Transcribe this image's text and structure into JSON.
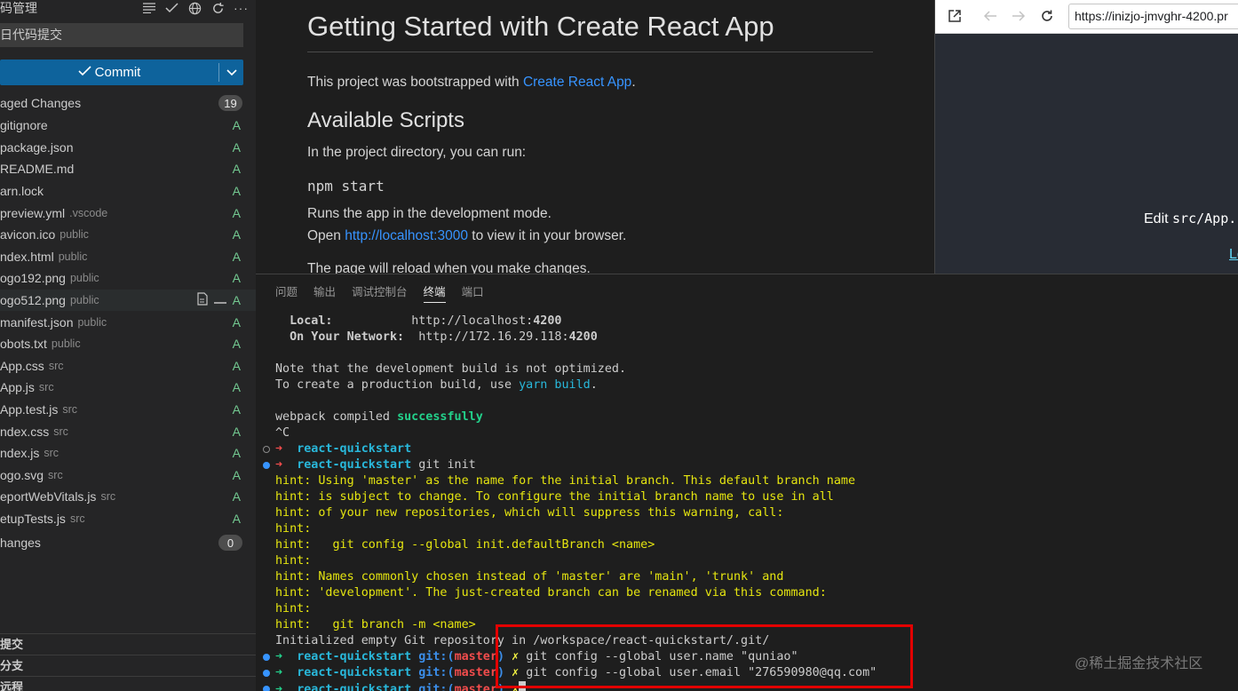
{
  "sidebar": {
    "title": "码管理",
    "commit_message": "日代码提交",
    "commit_label": "Commit",
    "staged_label": "aged Changes",
    "staged_count": "19",
    "changes_label": "hanges",
    "changes_count": "0",
    "files": [
      {
        "name": "gitignore",
        "path": "",
        "status": "A"
      },
      {
        "name": "package.json",
        "path": "",
        "status": "A"
      },
      {
        "name": "README.md",
        "path": "",
        "status": "A"
      },
      {
        "name": "arn.lock",
        "path": "",
        "status": "A"
      },
      {
        "name": "preview.yml",
        "path": ".vscode",
        "status": "A"
      },
      {
        "name": "avicon.ico",
        "path": "public",
        "status": "A"
      },
      {
        "name": "ndex.html",
        "path": "public",
        "status": "A"
      },
      {
        "name": "ogo192.png",
        "path": "public",
        "status": "A"
      },
      {
        "name": "ogo512.png",
        "path": "public",
        "status": "A"
      },
      {
        "name": "manifest.json",
        "path": "public",
        "status": "A"
      },
      {
        "name": "obots.txt",
        "path": "public",
        "status": "A"
      },
      {
        "name": "App.css",
        "path": "src",
        "status": "A"
      },
      {
        "name": "App.js",
        "path": "src",
        "status": "A"
      },
      {
        "name": "App.test.js",
        "path": "src",
        "status": "A"
      },
      {
        "name": "ndex.css",
        "path": "src",
        "status": "A"
      },
      {
        "name": "ndex.js",
        "path": "src",
        "status": "A"
      },
      {
        "name": "ogo.svg",
        "path": "src",
        "status": "A"
      },
      {
        "name": "eportWebVitals.js",
        "path": "src",
        "status": "A"
      },
      {
        "name": "etupTests.js",
        "path": "src",
        "status": "A"
      }
    ],
    "bottom_sections": [
      "提交",
      "分支",
      "远程"
    ]
  },
  "preview": {
    "title": "Getting Started with Create React App",
    "intro_text": "This project was bootstrapped with ",
    "intro_link": "Create React App",
    "intro_end": ".",
    "scripts_heading": "Available Scripts",
    "scripts_intro": "In the project directory, you can run:",
    "npm_start": "npm start",
    "runs_text": "Runs the app in the development mode.",
    "open_text": "Open ",
    "open_link": "http://localhost:3000",
    "open_end": " to view it in your browser.",
    "reload_text": "The page will reload when you make changes."
  },
  "browser": {
    "url": "https://inizjo-jmvghr-4200.pr",
    "edit_prefix": "Edit ",
    "edit_code": "src/App.",
    "learn_text": "Le"
  },
  "panel": {
    "tabs": [
      "问题",
      "输出",
      "调试控制台",
      "终端",
      "端口"
    ],
    "active_tab": "终端"
  },
  "terminal": {
    "local_label": "Local:",
    "local_url_prefix": "http://localhost:",
    "local_port": "4200",
    "network_label": "On Your Network:",
    "network_url_prefix": "http://172.16.29.118:",
    "network_port": "4200",
    "note_line": "Note that the development build is not optimized.",
    "create_line_a": "To create a production build, use ",
    "create_line_cmd": "yarn build",
    "create_line_b": ".",
    "webpack_a": "webpack compiled ",
    "webpack_b": "successfully",
    "ctrl_c": "^C",
    "prompt_dir": "react-quickstart",
    "git_init": "git init",
    "hints": [
      "hint: Using 'master' as the name for the initial branch. This default branch name",
      "hint: is subject to change. To configure the initial branch name to use in all",
      "hint: of your new repositories, which will suppress this warning, call:",
      "hint:",
      "hint:   git config --global init.defaultBranch <name>",
      "hint:",
      "hint: Names commonly chosen instead of 'master' are 'main', 'trunk' and",
      "hint: 'development'. The just-created branch can be renamed via this command:",
      "hint:",
      "hint:   git branch -m <name>"
    ],
    "init_done": "Initialized empty Git repository in /workspace/react-quickstart/.git/",
    "git_label": "git:(",
    "branch": "master",
    "git_close": ")",
    "x_mark": "✗",
    "cmd_name": "git config --global user.name \"quniao\"",
    "cmd_email": "git config --global user.email \"276590980@qq.com\""
  },
  "watermark": "@稀土掘金技术社区",
  "colors": {
    "accent_blue": "#0e639c",
    "added_green": "#73c991",
    "highlight_red": "#e30000"
  }
}
